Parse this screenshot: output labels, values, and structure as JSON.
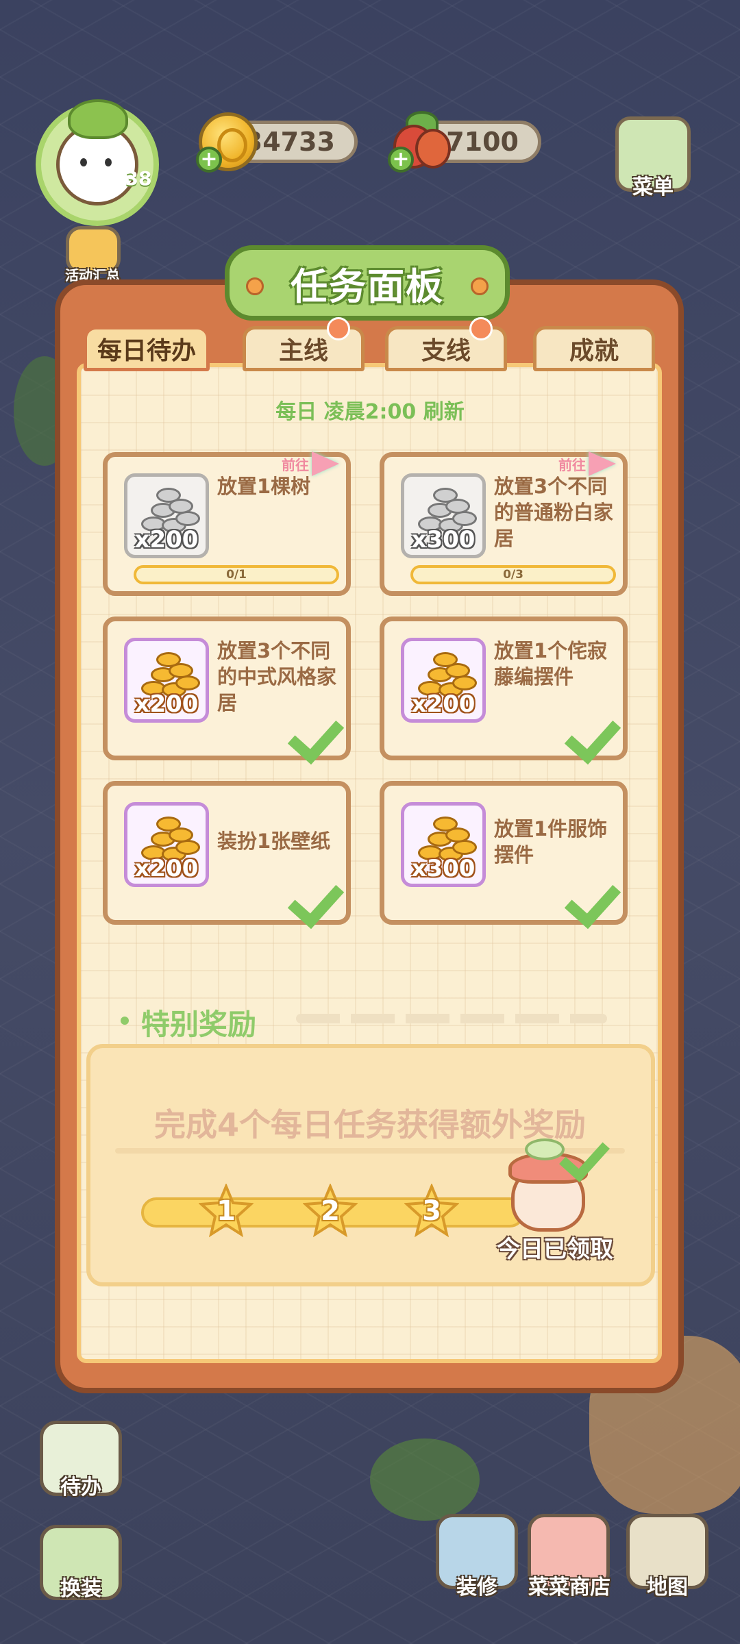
{
  "hud": {
    "level": "38",
    "coins": "34733",
    "veggies": "7100",
    "menu_label": "菜单",
    "events_label": "活动汇总"
  },
  "panel": {
    "title": "任务面板",
    "tabs": [
      {
        "label": "每日待办",
        "active": true
      },
      {
        "label": "主线",
        "has_notice": true
      },
      {
        "label": "支线",
        "has_notice": true
      },
      {
        "label": "成就"
      }
    ],
    "refresh_text": "每日 凌晨2:00 刷新",
    "tasks": [
      {
        "text": "放置1棵树",
        "reward": "x200",
        "reward_type": "silver",
        "progress": "0/1",
        "status": "in_progress",
        "goto_label": "前往"
      },
      {
        "text": "放置3个不同的普通粉白家居",
        "reward": "x300",
        "reward_type": "silver",
        "progress": "0/3",
        "status": "in_progress",
        "goto_label": "前往"
      },
      {
        "text": "放置3个不同的中式风格家居",
        "reward": "x200",
        "reward_type": "gold",
        "status": "completed"
      },
      {
        "text": "放置1个侘寂藤编摆件",
        "reward": "x200",
        "reward_type": "gold",
        "status": "completed"
      },
      {
        "text": "装扮1张壁纸",
        "reward": "x200",
        "reward_type": "gold",
        "status": "completed"
      },
      {
        "text": "放置1件服饰摆件",
        "reward": "x300",
        "reward_type": "gold",
        "status": "completed"
      }
    ],
    "special": {
      "title": "特别奖励",
      "description": "完成4个每日任务获得额外奖励",
      "milestones": [
        "1",
        "2",
        "3"
      ],
      "claimed_label": "今日已领取"
    }
  },
  "bottom_bar": {
    "todo_label": "待办",
    "outfit_label": "换装",
    "decorate_label": "装修",
    "shop_label": "菜菜商店",
    "map_label": "地图"
  }
}
